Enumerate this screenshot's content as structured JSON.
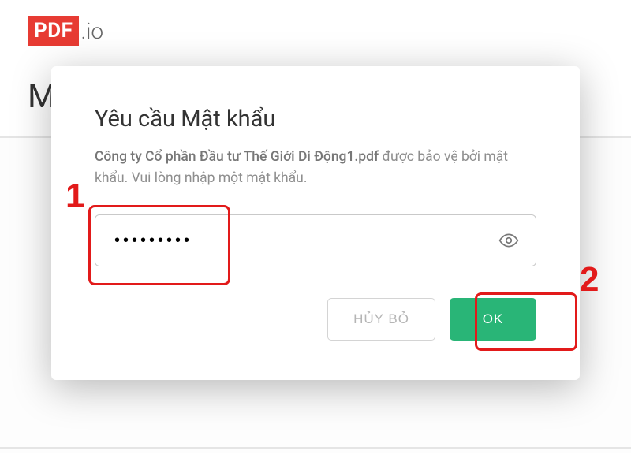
{
  "logo": {
    "pdf": "PDF",
    "io": ".io"
  },
  "page": {
    "title_initial": "M"
  },
  "modal": {
    "title": "Yêu cầu Mật khẩu",
    "filename": "Công ty Cổ phần Đầu tư Thế Giới Di Động1.pdf",
    "desc_suffix": " được bảo vệ bởi mật khẩu. Vui lòng nhập một mật khẩu.",
    "password_value": "•••••••••",
    "cancel_label": "HỦY BỎ",
    "ok_label": "OK"
  },
  "annotations": {
    "one": "1",
    "two": "2"
  }
}
